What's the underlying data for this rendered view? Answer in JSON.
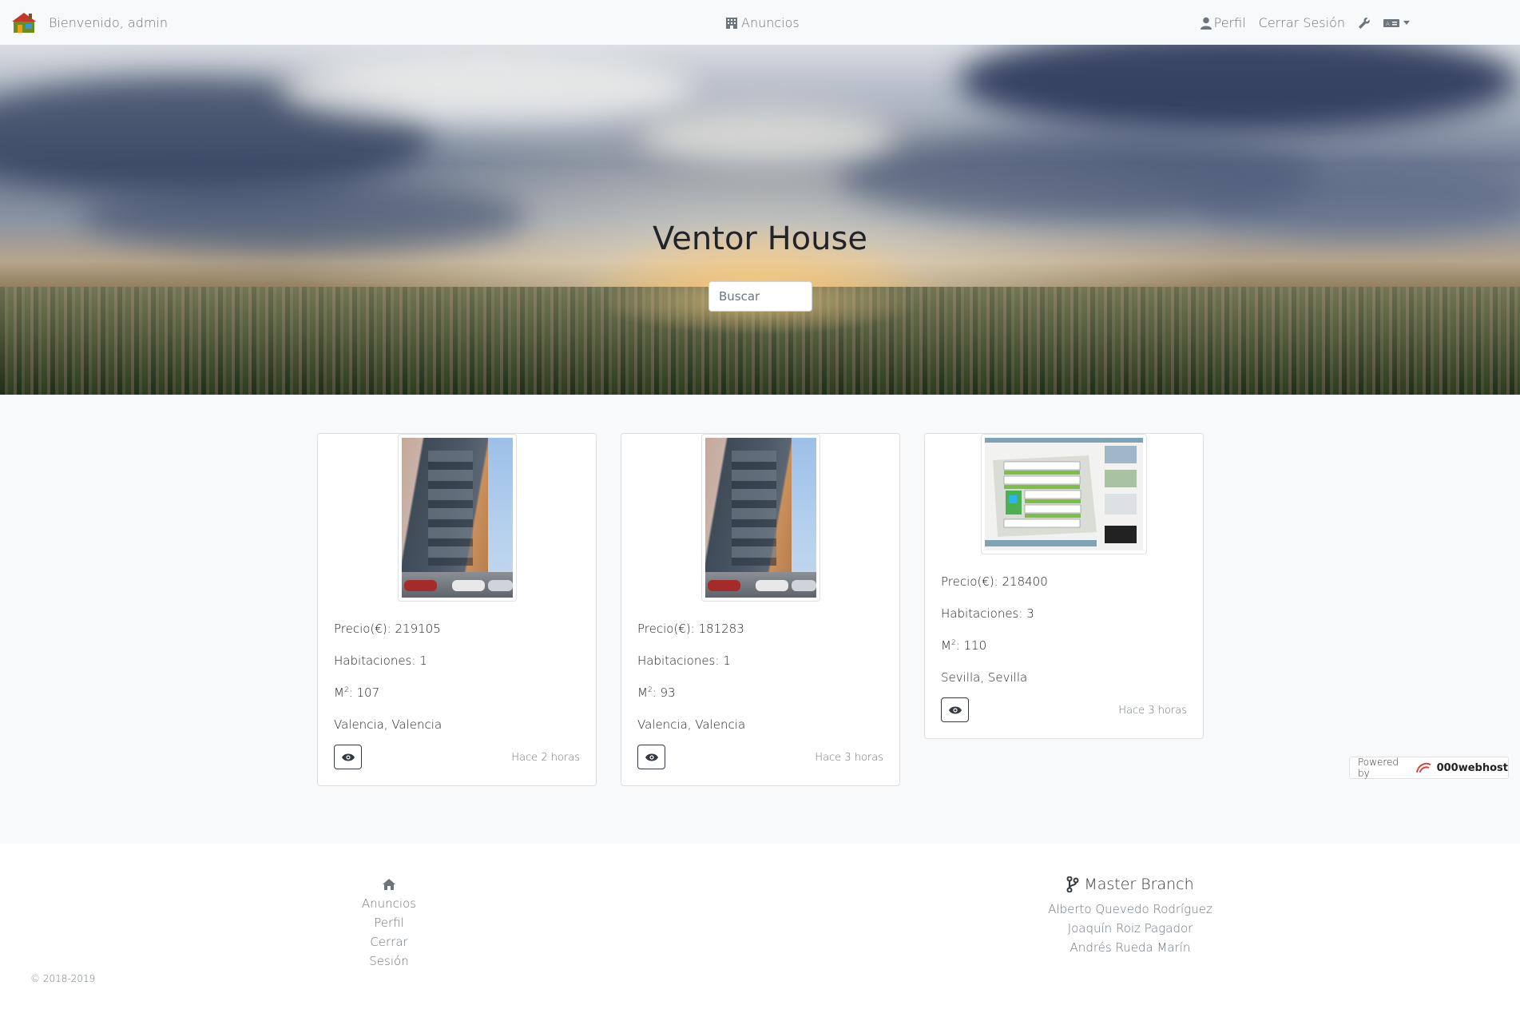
{
  "navbar": {
    "welcome": "Bienvenido, admin",
    "ads_link": "Anuncios",
    "profile_link": "Perfil",
    "logout_link": "Cerrar Sesión"
  },
  "hero": {
    "title": "Ventor House",
    "search_placeholder": "Buscar"
  },
  "listings": [
    {
      "price": "Precio(€): 219105",
      "rooms": "Habitaciones: 1",
      "area_value": ": 107",
      "location": "Valencia, Valencia",
      "time": "Hace 2 horas"
    },
    {
      "price": "Precio(€): 181283",
      "rooms": "Habitaciones: 1",
      "area_value": ": 93",
      "location": "Valencia, Valencia",
      "time": "Hace 3 horas"
    },
    {
      "price": "Precio(€): 218400",
      "rooms": "Habitaciones: 3",
      "area_value": ": 110",
      "location": "Sevilla, Sevilla",
      "time": "Hace 3 horas"
    }
  ],
  "area_unit": "M",
  "area_sup": "2",
  "powered": {
    "prefix": "Powered by",
    "brand": "000webhost"
  },
  "footer": {
    "links": [
      "Anuncios",
      "Perfil",
      "Cerrar Sesión"
    ],
    "team_title": "Master Branch",
    "team": [
      "Alberto Quevedo Rodríguez",
      "Joaquín Roiz Pagador",
      "Andrés Rueda Marín"
    ],
    "copyright": "© 2018-2019"
  }
}
